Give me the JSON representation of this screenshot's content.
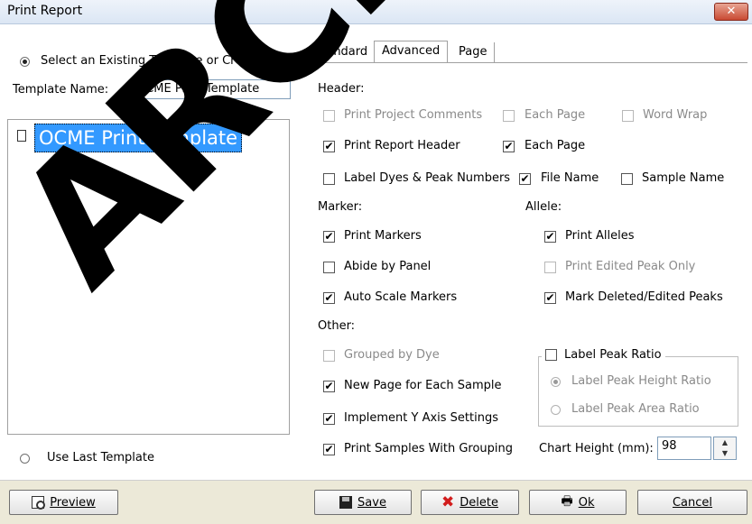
{
  "window": {
    "title": "Print Report",
    "close_icon": "close-icon",
    "close_glyph": "✕"
  },
  "left": {
    "select_template_radio": "Select an Existing Template or Create One",
    "template_name_label": "Template Name:",
    "template_name_value": "OCME Print Template",
    "tree_item": "OCME Print Template",
    "use_last_radio": "Use Last Template"
  },
  "tabs": [
    "Standard",
    "Advanced",
    "Page"
  ],
  "header_section": {
    "label": "Header:",
    "print_project_comments": "Print Project Comments",
    "each_page_1": "Each Page",
    "word_wrap": "Word Wrap",
    "print_report_header": "Print Report Header",
    "each_page_2": "Each Page",
    "label_dyes": "Label Dyes & Peak Numbers",
    "file_name": "File Name",
    "sample_name": "Sample Name"
  },
  "marker_section": {
    "label": "Marker:",
    "print_markers": "Print Markers",
    "abide_by_panel": "Abide by Panel",
    "auto_scale_markers": "Auto Scale Markers"
  },
  "allele_section": {
    "label": "Allele:",
    "print_alleles": "Print Alleles",
    "print_edited_peak_only": "Print Edited Peak Only",
    "mark_deleted": "Mark Deleted/Edited Peaks"
  },
  "other_section": {
    "label": "Other:",
    "grouped_by_dye": "Grouped by Dye",
    "new_page": "New Page for Each Sample",
    "implement_y_axis": "Implement  Y Axis Settings",
    "print_samples_grouping": "Print Samples With Grouping"
  },
  "peak_ratio": {
    "label": "Label Peak Ratio",
    "height_ratio": "Label Peak Height Ratio",
    "area_ratio": "Label Peak Area Ratio"
  },
  "chart_height": {
    "label": "Chart Height (mm):",
    "value": "98"
  },
  "buttons": {
    "preview": "Preview",
    "save": "Save",
    "delete": "Delete",
    "ok": "Ok",
    "cancel": "Cancel"
  },
  "checked_glyph": "✔",
  "spin_up_glyph": "▲",
  "spin_down_glyph": "▼",
  "watermark": "ARCHIVED"
}
